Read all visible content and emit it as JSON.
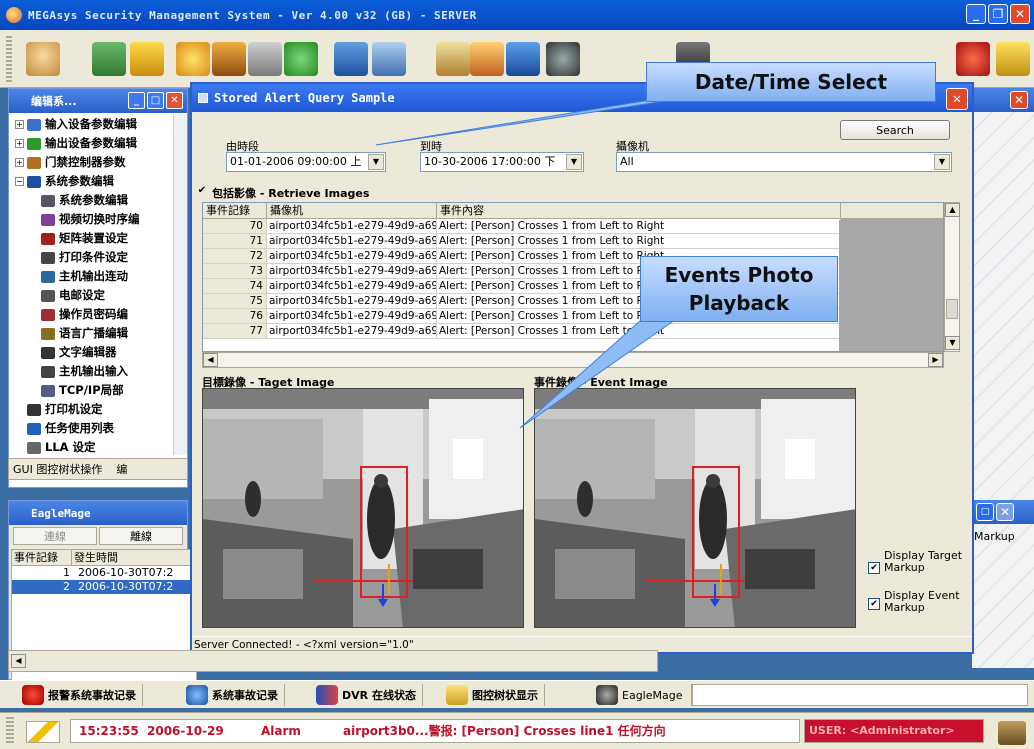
{
  "app": {
    "title": "MEGAsys Security Management System - Ver 4.00 v32    (GB)    - SERVER"
  },
  "editor_panel": {
    "title": "编辑系...",
    "tree": [
      {
        "label": "输入设备参数编辑",
        "expander": "+"
      },
      {
        "label": "输出设备参数编辑",
        "expander": "+"
      },
      {
        "label": "门禁控制器参数",
        "expander": "+"
      },
      {
        "label": "系统参数编辑",
        "expander": "−"
      },
      {
        "label": "系统参数编辑",
        "expander": ""
      },
      {
        "label": "视频切换时序编",
        "expander": ""
      },
      {
        "label": "矩阵装置设定",
        "expander": ""
      },
      {
        "label": "打印条件设定",
        "expander": ""
      },
      {
        "label": "主机输出连动",
        "expander": ""
      },
      {
        "label": "电邮设定",
        "expander": ""
      },
      {
        "label": "操作员密码编",
        "expander": ""
      },
      {
        "label": "语言广播编辑",
        "expander": ""
      },
      {
        "label": "文字编辑器",
        "expander": ""
      },
      {
        "label": "主机输出输入",
        "expander": ""
      },
      {
        "label": "TCP/IP局部",
        "expander": ""
      },
      {
        "label": "打印机设定",
        "expander": ""
      },
      {
        "label": "任务使用列表",
        "expander": ""
      },
      {
        "label": "LLA 设定",
        "expander": ""
      }
    ],
    "bottom_tab_1": "GUI 图控树状操作",
    "bottom_tab_2": "编"
  },
  "eagle_panel": {
    "title": "EagleMage",
    "online_btn": "連線",
    "offline_btn": "離線",
    "col1": "事件記錄",
    "col2": "發生時間",
    "rows": [
      {
        "id": "1",
        "time": "2006-10-30T07:2"
      },
      {
        "id": "2",
        "time": "2006-10-30T07:2"
      }
    ],
    "right_cut_text": "Markup"
  },
  "dialog": {
    "title": "Stored Alert Query Sample",
    "from_label": "由時段",
    "from_value": "01-01-2006 09:00:00 上",
    "to_label": "到時",
    "to_value": "10-30-2006 17:00:00 下",
    "camera_label": "攝像机",
    "camera_value": "All",
    "search_label": "Search",
    "retrieve_images_label": "包括影像 - Retrieve Images",
    "grid_headers": [
      "事件記錄",
      "攝像机",
      "事件內容"
    ],
    "grid_rows": [
      {
        "id": "70",
        "camera": "airport034fc5b1-e279-49d9-a69b-6",
        "event": "Alert: [Person] Crosses 1 from Left to Right"
      },
      {
        "id": "71",
        "camera": "airport034fc5b1-e279-49d9-a69b-6",
        "event": "Alert: [Person] Crosses 1 from Left to Right"
      },
      {
        "id": "72",
        "camera": "airport034fc5b1-e279-49d9-a69b-6",
        "event": "Alert: [Person] Crosses 1 from Left to Right"
      },
      {
        "id": "73",
        "camera": "airport034fc5b1-e279-49d9-a69b-6",
        "event": "Alert: [Person] Crosses 1 from Left to Right"
      },
      {
        "id": "74",
        "camera": "airport034fc5b1-e279-49d9-a69b-6",
        "event": "Alert: [Person] Crosses 1 from Left to Right"
      },
      {
        "id": "75",
        "camera": "airport034fc5b1-e279-49d9-a69b-6",
        "event": "Alert: [Person] Crosses 1 from Left to Right"
      },
      {
        "id": "76",
        "camera": "airport034fc5b1-e279-49d9-a69b-6",
        "event": "Alert: [Person] Crosses 1 from Left to Right"
      },
      {
        "id": "77",
        "camera": "airport034fc5b1-e279-49d9-a69b-6",
        "event": "Alert: [Person] Crosses 1 from Left to Right"
      }
    ],
    "target_image_label": "目標錄像 - Taget Image",
    "event_image_label": "事件錄像 - Event Image",
    "display_target_markup": "Display Target Markup",
    "display_event_markup": "Display Event Markup",
    "status": "Server Connected! - <?xml version=\"1.0\""
  },
  "callouts": {
    "datetime": "Date/Time Select",
    "playback_line1": "Events Photo",
    "playback_line2": "Playback"
  },
  "taskbar": [
    {
      "label": "报警系统事故记录",
      "icon": "alarm-icon"
    },
    {
      "label": "系统事故记录",
      "icon": "log-icon"
    },
    {
      "label": "DVR 在线状态",
      "icon": "dvr-icon"
    },
    {
      "label": "图控树状显示",
      "icon": "tree-icon"
    },
    {
      "label": "EagleMage",
      "icon": "camera-icon"
    }
  ],
  "statusbar": {
    "time": "15:23:55",
    "date": "2006-10-29",
    "type": "Alarm",
    "message": "airport3b0...警报: [Person] Crosses line1 任何方向",
    "user": "USER: <Administrator>"
  },
  "colors": {
    "xp_blue": "#2b5fc7",
    "alarm_red": "#c0102a",
    "selection": "#316ac5",
    "markup_box": "#e02020"
  }
}
